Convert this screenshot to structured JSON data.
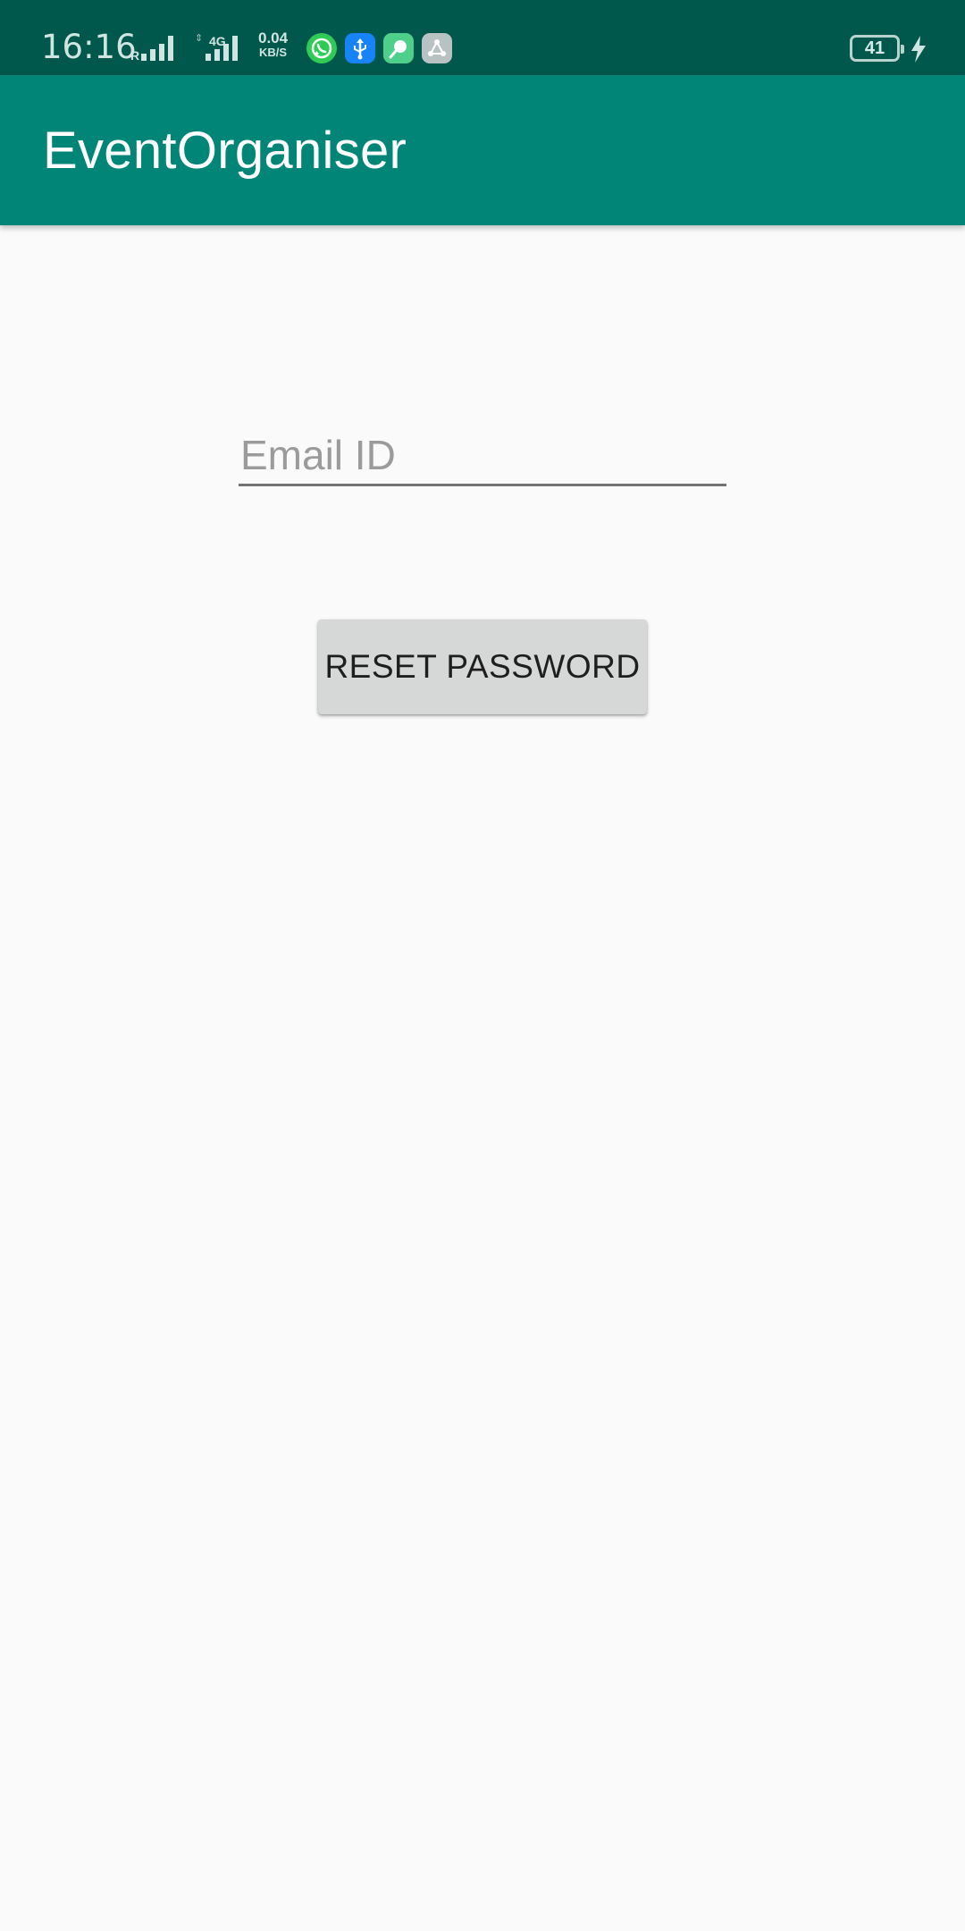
{
  "status_bar": {
    "time": "16:16",
    "sim1_label": "R",
    "sim2_label": "4G",
    "net_speed_value": "0.04",
    "net_speed_unit": "KB/S",
    "battery_level": "41",
    "notification_icons": [
      "whatsapp-icon",
      "usb-icon",
      "green-app-icon",
      "share-network-icon"
    ]
  },
  "app_bar": {
    "title": "EventOrganiser"
  },
  "form": {
    "email_placeholder": "Email ID",
    "email_value": "",
    "reset_button_label": "RESET PASSWORD"
  },
  "colors": {
    "status_bar": "#00574b",
    "app_bar": "#008577",
    "background": "#fafafa",
    "button": "#d6d7d7"
  }
}
